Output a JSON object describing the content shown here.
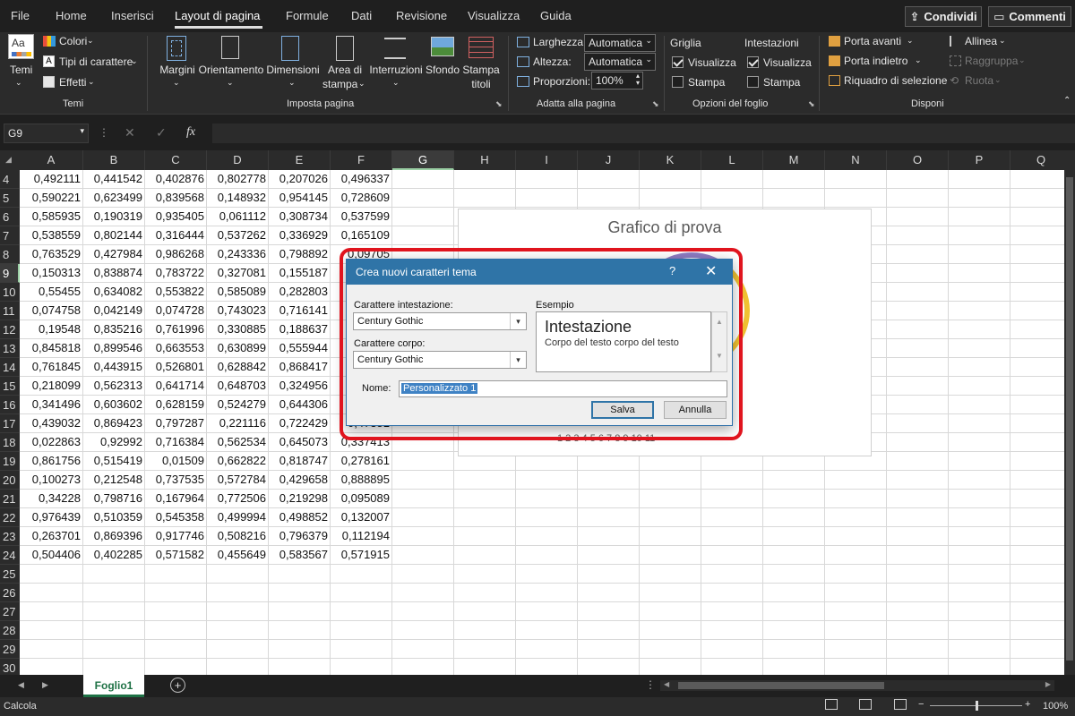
{
  "menu": {
    "tabs": [
      "File",
      "Home",
      "Inserisci",
      "Layout di pagina",
      "Formule",
      "Dati",
      "Revisione",
      "Visualizza",
      "Guida"
    ],
    "share_label": "Condividi",
    "comments_label": "Commenti"
  },
  "ribbon": {
    "temi": {
      "temi_label": "Temi",
      "colori": "Colori",
      "tipi_carattere": "Tipi di carattere",
      "effetti": "Effetti",
      "group": "Temi"
    },
    "imposta": {
      "margini": "Margini",
      "orientamento": "Orientamento",
      "dimensioni": "Dimensioni",
      "area_line1": "Area di",
      "area_line2": "stampa",
      "interruzioni": "Interruzioni",
      "sfondo": "Sfondo",
      "stampa_line1": "Stampa",
      "stampa_line2": "titoli",
      "group": "Imposta pagina"
    },
    "adatta": {
      "larghezza_label": "Larghezza:",
      "larghezza_value": "Automatica",
      "altezza_label": "Altezza:",
      "altezza_value": "Automatica",
      "proporzioni_label": "Proporzioni:",
      "proporzioni_value": "100%",
      "group": "Adatta alla pagina"
    },
    "opzioni": {
      "griglia": "Griglia",
      "intestazioni": "Intestazioni",
      "visualizza": "Visualizza",
      "stampa": "Stampa",
      "group": "Opzioni del foglio"
    },
    "disponi": {
      "porta_avanti": "Porta avanti",
      "porta_indietro": "Porta indietro",
      "riquadro": "Riquadro di selezione",
      "allinea": "Allinea",
      "raggruppa": "Raggruppa",
      "ruota": "Ruota",
      "group": "Disponi"
    }
  },
  "formula_bar": {
    "name_box": "G9",
    "fx": "fx"
  },
  "columns": [
    "A",
    "B",
    "C",
    "D",
    "E",
    "F",
    "G",
    "H",
    "I",
    "J",
    "K",
    "L",
    "M",
    "N",
    "O",
    "P",
    "Q"
  ],
  "rows": [
    "4",
    "5",
    "6",
    "7",
    "8",
    "9",
    "10",
    "11",
    "12",
    "13",
    "14",
    "15",
    "16",
    "17",
    "18",
    "19",
    "20",
    "21",
    "22",
    "23",
    "24",
    "25",
    "26",
    "27",
    "28",
    "29",
    "30"
  ],
  "cells": [
    [
      "0,492111",
      "0,441542",
      "0,402876",
      "0,802778",
      "0,207026",
      "0,496337"
    ],
    [
      "0,590221",
      "0,623499",
      "0,839568",
      "0,148932",
      "0,954145",
      "0,728609"
    ],
    [
      "0,585935",
      "0,190319",
      "0,935405",
      "0,061112",
      "0,308734",
      "0,537599"
    ],
    [
      "0,538559",
      "0,802144",
      "0,316444",
      "0,537262",
      "0,336929",
      "0,165109"
    ],
    [
      "0,763529",
      "0,427984",
      "0,986268",
      "0,243336",
      "0,798892",
      "0,09705"
    ],
    [
      "0,150313",
      "0,838874",
      "0,783722",
      "0,327081",
      "0,155187",
      ""
    ],
    [
      "0,55455",
      "0,634082",
      "0,553822",
      "0,585089",
      "0,282803",
      ""
    ],
    [
      "0,074758",
      "0,042149",
      "0,074728",
      "0,743023",
      "0,716141",
      ""
    ],
    [
      "0,19548",
      "0,835216",
      "0,761996",
      "0,330885",
      "0,188637",
      ""
    ],
    [
      "0,845818",
      "0,899546",
      "0,663553",
      "0,630899",
      "0,555944",
      ""
    ],
    [
      "0,761845",
      "0,443915",
      "0,526801",
      "0,628842",
      "0,868417",
      ""
    ],
    [
      "0,218099",
      "0,562313",
      "0,641714",
      "0,648703",
      "0,324956",
      ""
    ],
    [
      "0,341496",
      "0,603602",
      "0,628159",
      "0,524279",
      "0,644306",
      ""
    ],
    [
      "0,439032",
      "0,869423",
      "0,797287",
      "0,221116",
      "0,722429",
      "0,47351"
    ],
    [
      "0,022863",
      "0,92992",
      "0,716384",
      "0,562534",
      "0,645073",
      "0,337413"
    ],
    [
      "0,861756",
      "0,515419",
      "0,01509",
      "0,662822",
      "0,818747",
      "0,278161"
    ],
    [
      "0,100273",
      "0,212548",
      "0,737535",
      "0,572784",
      "0,429658",
      "0,888895"
    ],
    [
      "0,34228",
      "0,798716",
      "0,167964",
      "0,772506",
      "0,219298",
      "0,095089"
    ],
    [
      "0,976439",
      "0,510359",
      "0,545358",
      "0,499994",
      "0,498852",
      "0,132007"
    ],
    [
      "0,263701",
      "0,869396",
      "0,917746",
      "0,508216",
      "0,796379",
      "0,112194"
    ],
    [
      "0,504406",
      "0,402285",
      "0,571582",
      "0,455649",
      "0,583567",
      "0,571915"
    ]
  ],
  "chart": {
    "title": "Grafico di prova",
    "legend": "1   2   3   4   5   6   7   8   9   10   11"
  },
  "dialog": {
    "title": "Crea nuovi caratteri tema",
    "help": "?",
    "heading_font_label": "Carattere intestazione:",
    "heading_font_value": "Century Gothic",
    "body_font_label": "Carattere corpo:",
    "body_font_value": "Century Gothic",
    "sample_label": "Esempio",
    "sample_heading": "Intestazione",
    "sample_body": "Corpo del testo corpo del testo",
    "name_label": "Nome:",
    "name_value": "Personalizzato 1",
    "save": "Salva",
    "cancel": "Annulla"
  },
  "sheet": {
    "tab_name": "Foglio1"
  },
  "status": {
    "mode": "Calcola",
    "zoom": "100%"
  },
  "colors": {
    "accent_green": "#1e7145",
    "highlight_red": "#e0141e",
    "dialog_title": "#2f74a7"
  }
}
